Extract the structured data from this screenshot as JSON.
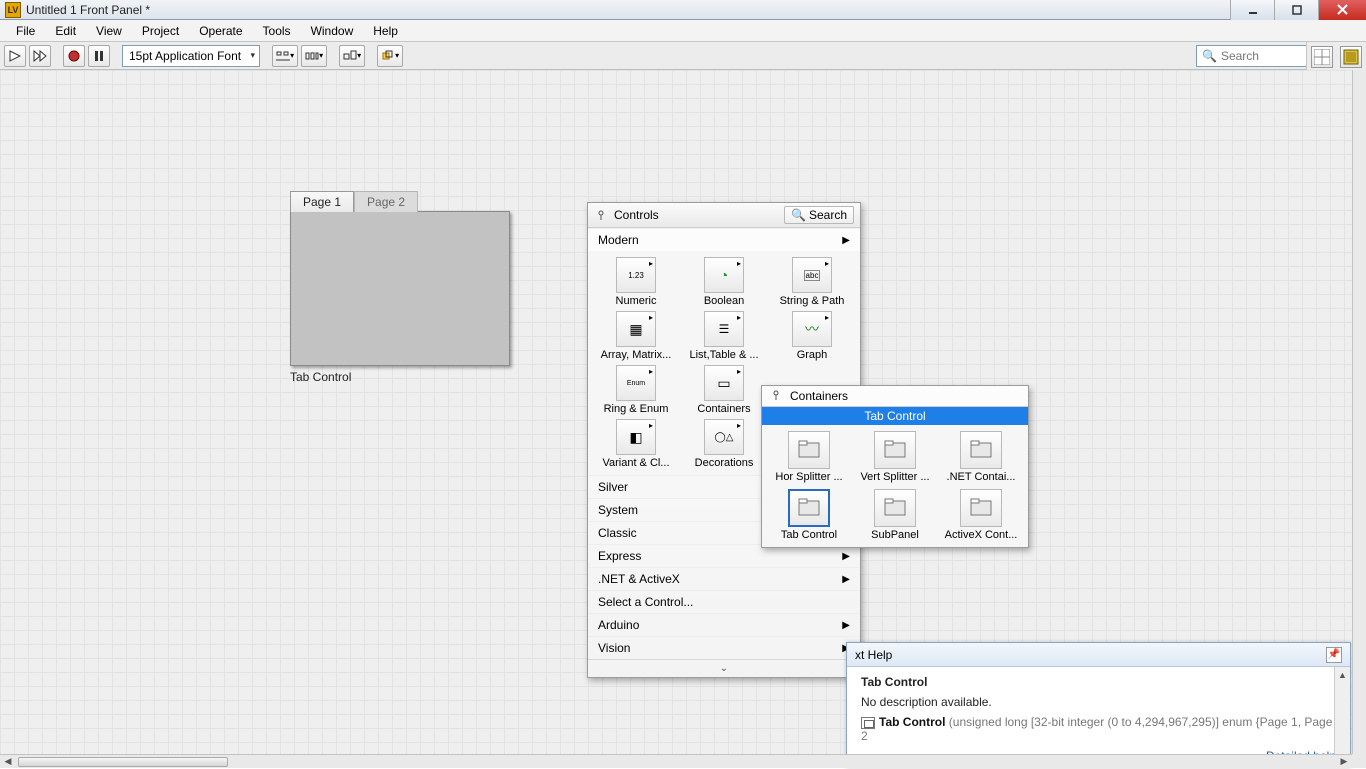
{
  "titlebar": {
    "title": "Untitled 1 Front Panel *"
  },
  "menus": [
    "File",
    "Edit",
    "View",
    "Project",
    "Operate",
    "Tools",
    "Window",
    "Help"
  ],
  "toolbar": {
    "font": "15pt Application Font",
    "search_placeholder": "Search"
  },
  "tab_control": {
    "tabs": [
      "Page 1",
      "Page 2"
    ],
    "label": "Tab Control"
  },
  "palette": {
    "title": "Controls",
    "search": "Search",
    "top_category": "Modern",
    "grid": [
      {
        "label": "Numeric",
        "icon": "ico-numeric"
      },
      {
        "label": "Boolean",
        "icon": "ico-boolean"
      },
      {
        "label": "String & Path",
        "icon": "ico-string"
      },
      {
        "label": "Array, Matrix...",
        "icon": "ico-array"
      },
      {
        "label": "List,Table & ...",
        "icon": "ico-list"
      },
      {
        "label": "Graph",
        "icon": "ico-graph"
      },
      {
        "label": "Ring & Enum",
        "icon": "ico-ring"
      },
      {
        "label": "Containers",
        "icon": "ico-container"
      },
      {
        "label": "",
        "icon": "ico-container"
      },
      {
        "label": "Variant & Cl...",
        "icon": "ico-variant"
      },
      {
        "label": "Decorations",
        "icon": "ico-deco"
      }
    ],
    "categories": [
      "Silver",
      "System",
      "Classic",
      "Express",
      ".NET & ActiveX",
      "Select a Control...",
      "Arduino",
      "Vision"
    ],
    "categories_arrow": [
      false,
      false,
      false,
      true,
      true,
      false,
      true,
      true
    ]
  },
  "flyout": {
    "title": "Containers",
    "highlight": "Tab Control",
    "items": [
      {
        "label": "Hor Splitter ..."
      },
      {
        "label": "Vert Splitter ..."
      },
      {
        "label": ".NET Contai..."
      },
      {
        "label": "Tab Control",
        "selected": true
      },
      {
        "label": "SubPanel"
      },
      {
        "label": "ActiveX Cont..."
      }
    ]
  },
  "context_help": {
    "header": "xt Help",
    "title": "Tab Control",
    "desc": "No description available.",
    "sig_name": "Tab Control",
    "sig_type": "(unsigned long [32-bit integer (0 to 4,294,967,295)] enum {Page 1, Page 2",
    "link": "Detailed help"
  }
}
